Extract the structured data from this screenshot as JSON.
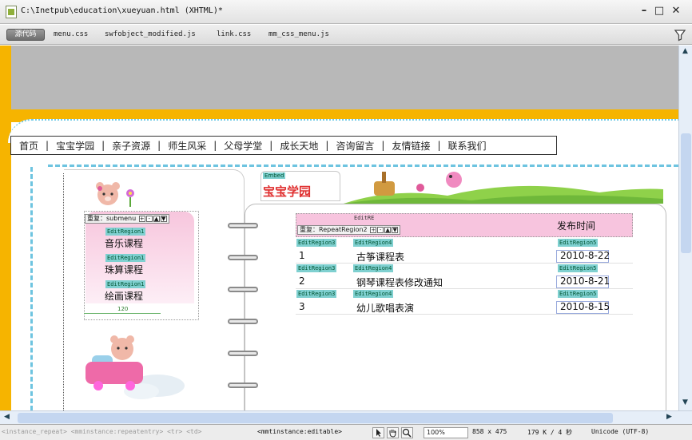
{
  "window": {
    "title": "C:\\Inetpub\\education\\xueyuan.html (XHTML)*",
    "minimize_glyph": "–",
    "restore_glyph": "□",
    "close_glyph": "✕"
  },
  "related_files": {
    "source_label": "源代码",
    "files": [
      "menu.css",
      "swfobject_modified.js",
      "link.css",
      "mm_css_menu.js"
    ]
  },
  "nav": {
    "items": [
      "首页",
      "宝宝学园",
      "亲子资源",
      "师生风采",
      "父母学堂",
      "成长天地",
      "咨询留言",
      "友情链接",
      "联系我们"
    ],
    "separator": "|"
  },
  "submenu": {
    "region_label": "重复：submenu",
    "edit_tag": "EditRegion1",
    "items": [
      "音乐课程",
      "珠算课程",
      "绘画课程"
    ],
    "width_label": "120",
    "controls": [
      "+",
      "-",
      "▲",
      "▼"
    ]
  },
  "banner": {
    "small_tag": "Embed",
    "title": "宝宝学园"
  },
  "table": {
    "head_small": "EditRE",
    "repeat_label": "重复：RepeatRegion2",
    "controls": [
      "+",
      "-",
      "▲",
      "▼"
    ],
    "date_header": "发布时间",
    "rows": [
      {
        "tag1": "EditRegion3",
        "num": "1",
        "tag2": "EditRegion4",
        "title": "古筝课程表",
        "tag3": "EditRegion5",
        "date": "2010-8-22"
      },
      {
        "tag1": "EditRegion3",
        "num": "2",
        "tag2": "EditRegion4",
        "title": "钢琴课程表修改通知",
        "tag3": "EditRegion5",
        "date": "2010-8-21"
      },
      {
        "tag1": "EditRegion3",
        "num": "3",
        "tag2": "EditRegion4",
        "title": "幼儿歌唱表演",
        "tag3": "EditRegion5",
        "date": "2010-8-15"
      }
    ]
  },
  "status": {
    "tag_path": "<instance_repeat> <mminstance:repeatentry> <tr> <td>",
    "current_tag": "<mmtinstance:editable>",
    "zoom": "100%",
    "size": "858 x 475",
    "file_info": "179 K / 4 秒",
    "encoding": "Unicode (UTF-8)"
  },
  "colors": {
    "gold": "#f6b400",
    "pink": "#f7c4de",
    "teal_tag": "#7fd0d0",
    "dash": "#6ec4e0"
  },
  "icons": [
    "document-icon",
    "filter-icon",
    "pointer-tool-icon",
    "hand-tool-icon",
    "zoom-tool-icon"
  ]
}
